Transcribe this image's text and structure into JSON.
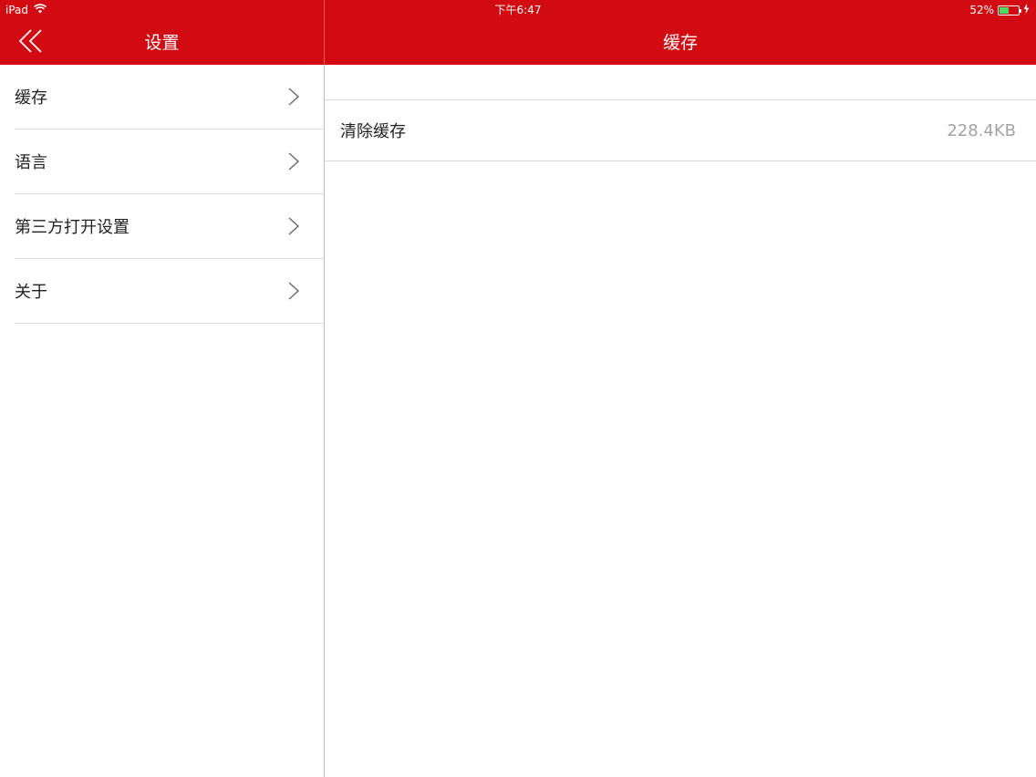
{
  "status_bar": {
    "device": "iPad",
    "time": "下午6:47",
    "battery_percent": "52%",
    "battery_level": 0.52,
    "icons": [
      "wifi-icon",
      "battery-icon",
      "charging-bolt-icon"
    ]
  },
  "colors": {
    "accent": "#d20b12",
    "battery_fill": "#4cd964",
    "secondary_text": "#a3a3a3"
  },
  "master": {
    "title": "设置",
    "back_icon": "double-chevron-left-icon",
    "items": [
      {
        "label": "缓存",
        "icon": "chevron-right-icon"
      },
      {
        "label": "语言",
        "icon": "chevron-right-icon"
      },
      {
        "label": "第三方打开设置",
        "icon": "chevron-right-icon"
      },
      {
        "label": "关于",
        "icon": "chevron-right-icon"
      }
    ]
  },
  "detail": {
    "title": "缓存",
    "rows": [
      {
        "label": "清除缓存",
        "value": "228.4KB"
      }
    ]
  }
}
